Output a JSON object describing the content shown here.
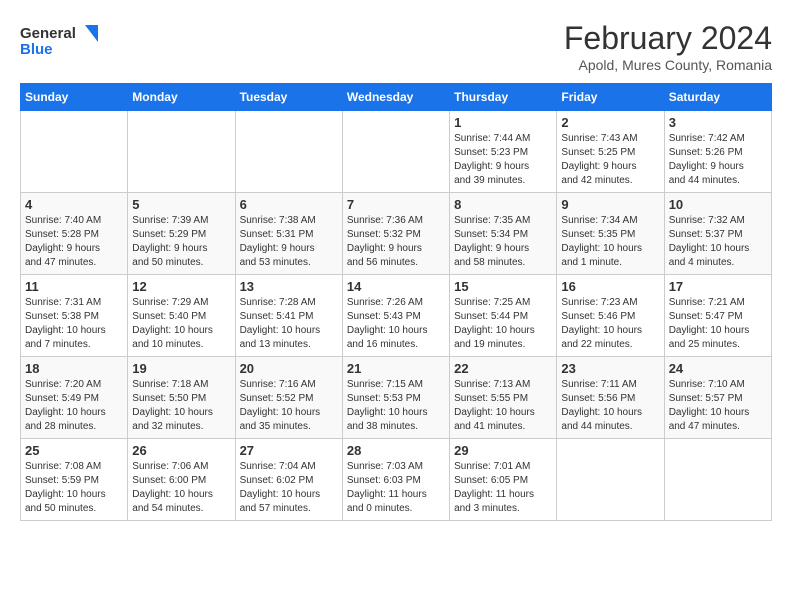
{
  "header": {
    "logo": {
      "general": "General",
      "blue": "Blue"
    },
    "title": "February 2024",
    "subtitle": "Apold, Mures County, Romania"
  },
  "columns": [
    "Sunday",
    "Monday",
    "Tuesday",
    "Wednesday",
    "Thursday",
    "Friday",
    "Saturday"
  ],
  "weeks": [
    [
      {
        "day": "",
        "info": ""
      },
      {
        "day": "",
        "info": ""
      },
      {
        "day": "",
        "info": ""
      },
      {
        "day": "",
        "info": ""
      },
      {
        "day": "1",
        "info": "Sunrise: 7:44 AM\nSunset: 5:23 PM\nDaylight: 9 hours\nand 39 minutes."
      },
      {
        "day": "2",
        "info": "Sunrise: 7:43 AM\nSunset: 5:25 PM\nDaylight: 9 hours\nand 42 minutes."
      },
      {
        "day": "3",
        "info": "Sunrise: 7:42 AM\nSunset: 5:26 PM\nDaylight: 9 hours\nand 44 minutes."
      }
    ],
    [
      {
        "day": "4",
        "info": "Sunrise: 7:40 AM\nSunset: 5:28 PM\nDaylight: 9 hours\nand 47 minutes."
      },
      {
        "day": "5",
        "info": "Sunrise: 7:39 AM\nSunset: 5:29 PM\nDaylight: 9 hours\nand 50 minutes."
      },
      {
        "day": "6",
        "info": "Sunrise: 7:38 AM\nSunset: 5:31 PM\nDaylight: 9 hours\nand 53 minutes."
      },
      {
        "day": "7",
        "info": "Sunrise: 7:36 AM\nSunset: 5:32 PM\nDaylight: 9 hours\nand 56 minutes."
      },
      {
        "day": "8",
        "info": "Sunrise: 7:35 AM\nSunset: 5:34 PM\nDaylight: 9 hours\nand 58 minutes."
      },
      {
        "day": "9",
        "info": "Sunrise: 7:34 AM\nSunset: 5:35 PM\nDaylight: 10 hours\nand 1 minute."
      },
      {
        "day": "10",
        "info": "Sunrise: 7:32 AM\nSunset: 5:37 PM\nDaylight: 10 hours\nand 4 minutes."
      }
    ],
    [
      {
        "day": "11",
        "info": "Sunrise: 7:31 AM\nSunset: 5:38 PM\nDaylight: 10 hours\nand 7 minutes."
      },
      {
        "day": "12",
        "info": "Sunrise: 7:29 AM\nSunset: 5:40 PM\nDaylight: 10 hours\nand 10 minutes."
      },
      {
        "day": "13",
        "info": "Sunrise: 7:28 AM\nSunset: 5:41 PM\nDaylight: 10 hours\nand 13 minutes."
      },
      {
        "day": "14",
        "info": "Sunrise: 7:26 AM\nSunset: 5:43 PM\nDaylight: 10 hours\nand 16 minutes."
      },
      {
        "day": "15",
        "info": "Sunrise: 7:25 AM\nSunset: 5:44 PM\nDaylight: 10 hours\nand 19 minutes."
      },
      {
        "day": "16",
        "info": "Sunrise: 7:23 AM\nSunset: 5:46 PM\nDaylight: 10 hours\nand 22 minutes."
      },
      {
        "day": "17",
        "info": "Sunrise: 7:21 AM\nSunset: 5:47 PM\nDaylight: 10 hours\nand 25 minutes."
      }
    ],
    [
      {
        "day": "18",
        "info": "Sunrise: 7:20 AM\nSunset: 5:49 PM\nDaylight: 10 hours\nand 28 minutes."
      },
      {
        "day": "19",
        "info": "Sunrise: 7:18 AM\nSunset: 5:50 PM\nDaylight: 10 hours\nand 32 minutes."
      },
      {
        "day": "20",
        "info": "Sunrise: 7:16 AM\nSunset: 5:52 PM\nDaylight: 10 hours\nand 35 minutes."
      },
      {
        "day": "21",
        "info": "Sunrise: 7:15 AM\nSunset: 5:53 PM\nDaylight: 10 hours\nand 38 minutes."
      },
      {
        "day": "22",
        "info": "Sunrise: 7:13 AM\nSunset: 5:55 PM\nDaylight: 10 hours\nand 41 minutes."
      },
      {
        "day": "23",
        "info": "Sunrise: 7:11 AM\nSunset: 5:56 PM\nDaylight: 10 hours\nand 44 minutes."
      },
      {
        "day": "24",
        "info": "Sunrise: 7:10 AM\nSunset: 5:57 PM\nDaylight: 10 hours\nand 47 minutes."
      }
    ],
    [
      {
        "day": "25",
        "info": "Sunrise: 7:08 AM\nSunset: 5:59 PM\nDaylight: 10 hours\nand 50 minutes."
      },
      {
        "day": "26",
        "info": "Sunrise: 7:06 AM\nSunset: 6:00 PM\nDaylight: 10 hours\nand 54 minutes."
      },
      {
        "day": "27",
        "info": "Sunrise: 7:04 AM\nSunset: 6:02 PM\nDaylight: 10 hours\nand 57 minutes."
      },
      {
        "day": "28",
        "info": "Sunrise: 7:03 AM\nSunset: 6:03 PM\nDaylight: 11 hours\nand 0 minutes."
      },
      {
        "day": "29",
        "info": "Sunrise: 7:01 AM\nSunset: 6:05 PM\nDaylight: 11 hours\nand 3 minutes."
      },
      {
        "day": "",
        "info": ""
      },
      {
        "day": "",
        "info": ""
      }
    ]
  ]
}
